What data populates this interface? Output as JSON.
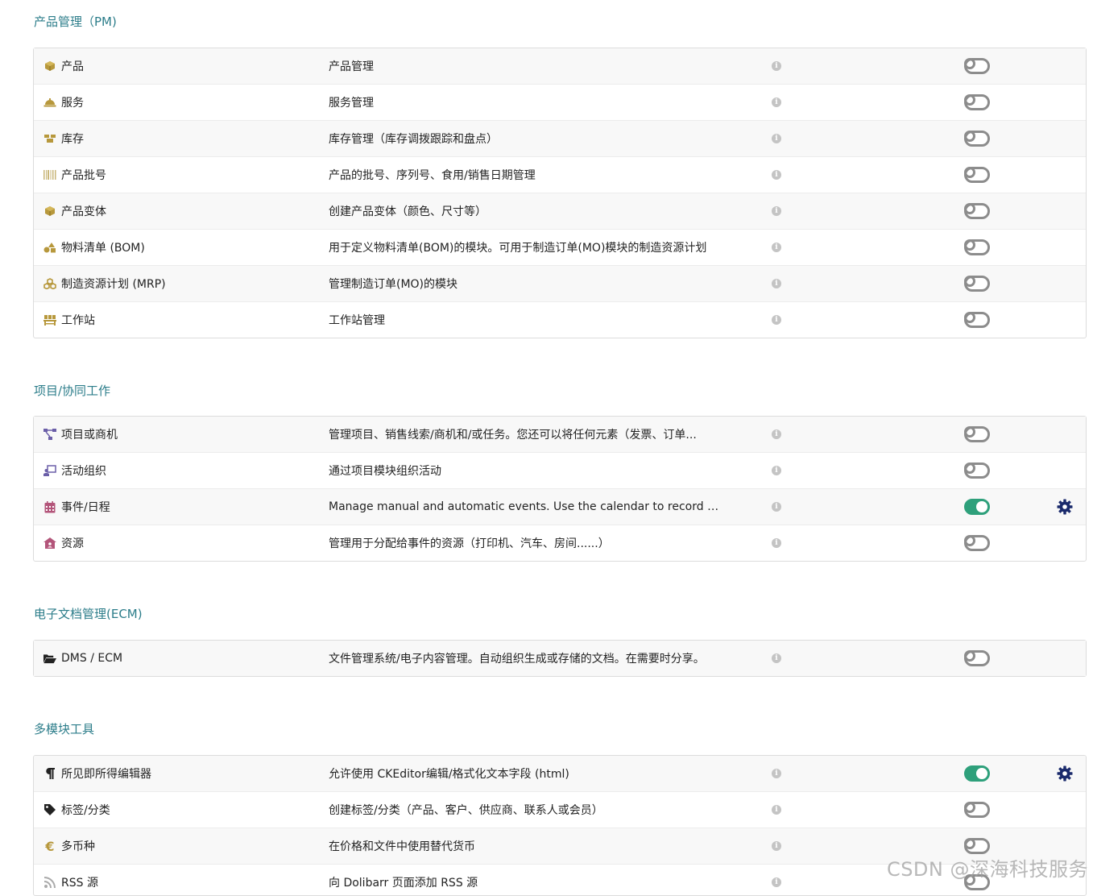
{
  "sections": [
    {
      "title": "产品管理（PM)",
      "rows": [
        {
          "name": "产品",
          "desc": "产品管理",
          "icon": "cube-icon",
          "enabled": false
        },
        {
          "name": "服务",
          "desc": "服务管理",
          "icon": "concierge-bell-icon",
          "enabled": false
        },
        {
          "name": "库存",
          "desc": "库存管理（库存调拨跟踪和盘点）",
          "icon": "boxes-icon",
          "enabled": false
        },
        {
          "name": "产品批号",
          "desc": "产品的批号、序列号、食用/销售日期管理",
          "icon": "barcode-icon",
          "enabled": false
        },
        {
          "name": "产品变体",
          "desc": "创建产品变体（颜色、尺寸等）",
          "icon": "cube-icon",
          "enabled": false
        },
        {
          "name": "物料清单 (BOM)",
          "desc": "用于定义物料清单(BOM)的模块。可用于制造订单(MO)模块的制造资源计划",
          "icon": "shapes-icon",
          "enabled": false
        },
        {
          "name": "制造资源计划 (MRP)",
          "desc": "管理制造订单(MO)的模块",
          "icon": "cubes-icon",
          "enabled": false
        },
        {
          "name": "工作站",
          "desc": "工作站管理",
          "icon": "workstation-icon",
          "enabled": false
        }
      ]
    },
    {
      "title": "项目/协同工作",
      "rows": [
        {
          "name": "项目或商机",
          "desc": "管理项目、销售线索/商机和/或任务。您还可以将任何元素（发票、订单...",
          "icon": "project-diagram-icon",
          "enabled": false
        },
        {
          "name": "活动组织",
          "desc": "通过项目模块组织活动",
          "icon": "chalkboard-user-icon",
          "enabled": false
        },
        {
          "name": "事件/日程",
          "desc": "Manage manual and automatic events. Use the calendar to record event...",
          "icon": "calendar-icon",
          "enabled": true,
          "settings": true
        },
        {
          "name": "资源",
          "desc": "管理用于分配给事件的资源（打印机、汽车、房间......）",
          "icon": "house-user-icon",
          "enabled": false
        }
      ]
    },
    {
      "title": "电子文档管理(ECM)",
      "rows": [
        {
          "name": "DMS / ECM",
          "desc": "文件管理系统/电子内容管理。自动组织生成或存储的文档。在需要时分享。",
          "icon": "folder-open-icon",
          "enabled": false
        }
      ]
    },
    {
      "title": "多模块工具",
      "rows": [
        {
          "name": "所见即所得编辑器",
          "desc": "允许使用 CKEditor编辑/格式化文本字段 (html)",
          "icon": "paragraph-icon",
          "enabled": true,
          "settings": true
        },
        {
          "name": "标签/分类",
          "desc": "创建标签/分类（产品、客户、供应商、联系人或会员）",
          "icon": "tag-icon",
          "enabled": false
        },
        {
          "name": "多币种",
          "desc": "在价格和文件中使用替代货币",
          "icon": "euro-icon",
          "enabled": false
        },
        {
          "name": "RSS 源",
          "desc": "向 Dolibarr 页面添加 RSS 源",
          "icon": "rss-icon",
          "enabled": false
        }
      ]
    }
  ],
  "watermark": "CSDN @深海科技服务",
  "colors": {
    "section_title": "#2c7d8a",
    "toggle_on": "#2ea07b",
    "gear": "#1a2a6c"
  }
}
